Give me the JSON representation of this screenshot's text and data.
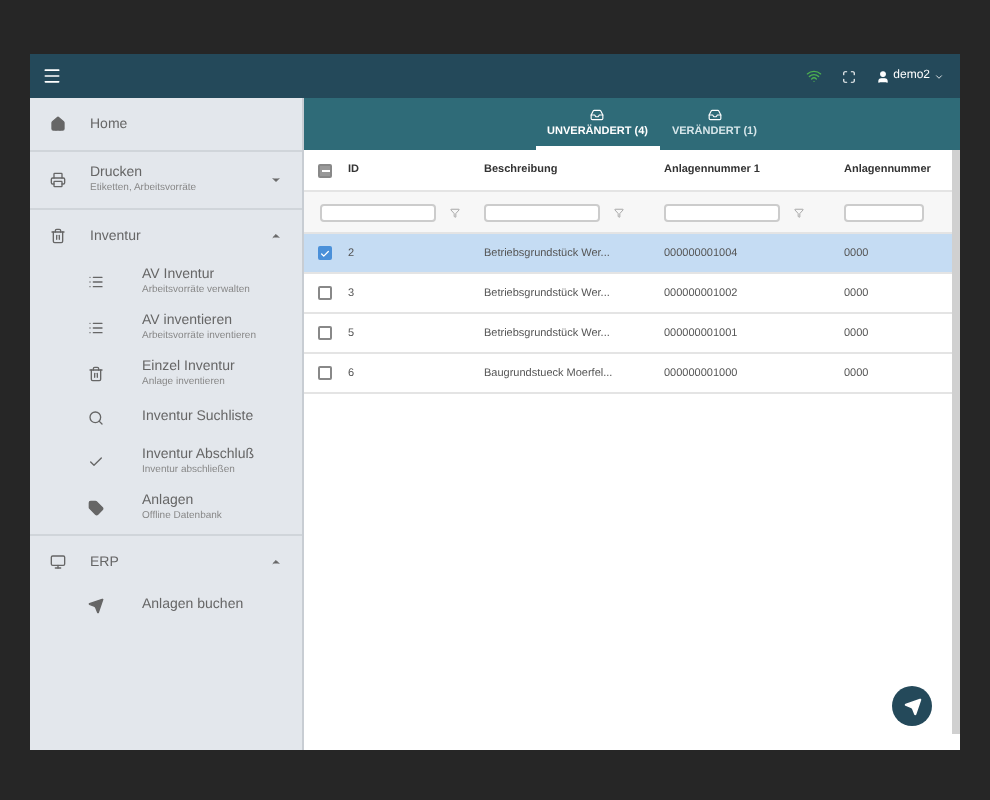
{
  "top_bar": {
    "user": "demo2",
    "online": true
  },
  "sidebar": {
    "items": [
      {
        "label": "Home"
      },
      {
        "label": "Drucken",
        "subtitle": "Etiketten, Arbeitsvorräte",
        "expanded": false
      },
      {
        "label": "Inventur",
        "expanded": true,
        "children": [
          {
            "label": "AV Inventur",
            "subtitle": "Arbeitsvorräte verwalten"
          },
          {
            "label": "AV inventieren",
            "subtitle": "Arbeitsvorräte inventieren"
          },
          {
            "label": "Einzel Inventur",
            "subtitle": "Anlage inventieren"
          },
          {
            "label": "Inventur Suchliste"
          },
          {
            "label": "Inventur Abschluß",
            "subtitle": "Inventur abschließen"
          },
          {
            "label": "Anlagen",
            "subtitle": "Offline Datenbank"
          }
        ]
      },
      {
        "label": "ERP",
        "expanded": true,
        "children": [
          {
            "label": "Anlagen buchen"
          }
        ]
      }
    ]
  },
  "tabs": [
    {
      "label": "UNVERÄNDERT (4)",
      "selected": true
    },
    {
      "label": "VERÄNDERT (1)",
      "selected": false
    }
  ],
  "table": {
    "select_all": {
      "indeterminate": true
    },
    "columns": [
      "ID",
      "Beschreibung",
      "Anlagennummer 1",
      "Anlagennummer"
    ],
    "rows": [
      {
        "cells": [
          "2",
          "Betriebsgrundstück Wer...",
          "000000001004",
          "0000"
        ],
        "checked": true
      },
      {
        "cells": [
          "3",
          "Betriebsgrundstück Wer...",
          "000000001002",
          "0000"
        ],
        "checked": false
      },
      {
        "cells": [
          "5",
          "Betriebsgrundstück Wer...",
          "000000001001",
          "0000"
        ],
        "checked": false
      },
      {
        "cells": [
          "6",
          "Baugrundstueck Moerfel...",
          "000000001000",
          "0000"
        ],
        "checked": false
      }
    ]
  }
}
